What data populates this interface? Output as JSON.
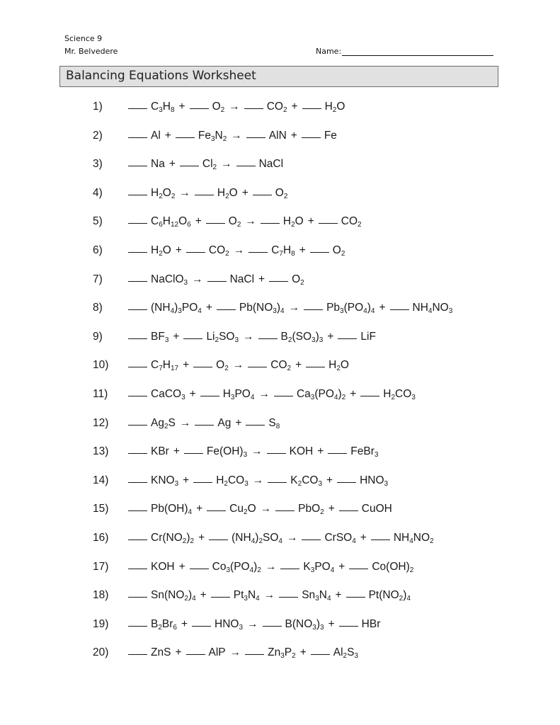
{
  "header": {
    "course": "Science 9",
    "teacher": "Mr. Belvedere",
    "name_label": "Name:"
  },
  "title": "Balancing Equations Worksheet",
  "symbols": {
    "plus": "+",
    "arrow": "→"
  },
  "equations": [
    {
      "number": "1)",
      "reactants": [
        [
          [
            "C"
          ],
          [
            "3",
            "s"
          ],
          [
            "H"
          ],
          [
            "8",
            "s"
          ]
        ],
        [
          [
            "O"
          ],
          [
            "2",
            "s"
          ]
        ]
      ],
      "products": [
        [
          [
            "CO"
          ],
          [
            "2",
            "s"
          ]
        ],
        [
          [
            "H"
          ],
          [
            "2",
            "s"
          ],
          [
            "O"
          ]
        ]
      ]
    },
    {
      "number": "2)",
      "reactants": [
        [
          [
            "Al"
          ]
        ],
        [
          [
            "Fe"
          ],
          [
            "3",
            "s"
          ],
          [
            "N"
          ],
          [
            "2",
            "s"
          ]
        ]
      ],
      "products": [
        [
          [
            "AlN"
          ]
        ],
        [
          [
            "Fe"
          ]
        ]
      ]
    },
    {
      "number": "3)",
      "reactants": [
        [
          [
            "Na"
          ]
        ],
        [
          [
            "Cl"
          ],
          [
            "2",
            "s"
          ]
        ]
      ],
      "products": [
        [
          [
            "NaCl"
          ]
        ]
      ]
    },
    {
      "number": "4)",
      "reactants": [
        [
          [
            "H"
          ],
          [
            "2",
            "s"
          ],
          [
            "O"
          ],
          [
            "2",
            "s"
          ]
        ]
      ],
      "products": [
        [
          [
            "H"
          ],
          [
            "2",
            "s"
          ],
          [
            "O"
          ]
        ],
        [
          [
            "O"
          ],
          [
            "2",
            "s"
          ]
        ]
      ]
    },
    {
      "number": "5)",
      "reactants": [
        [
          [
            "C"
          ],
          [
            "6",
            "s"
          ],
          [
            "H"
          ],
          [
            "12",
            "s"
          ],
          [
            "O"
          ],
          [
            "6",
            "s"
          ]
        ],
        [
          [
            "O"
          ],
          [
            "2",
            "s"
          ]
        ]
      ],
      "products": [
        [
          [
            "H"
          ],
          [
            "2",
            "s"
          ],
          [
            "O"
          ]
        ],
        [
          [
            "CO"
          ],
          [
            "2",
            "s"
          ]
        ]
      ]
    },
    {
      "number": "6)",
      "reactants": [
        [
          [
            "H"
          ],
          [
            "2",
            "s"
          ],
          [
            "O"
          ]
        ],
        [
          [
            "CO"
          ],
          [
            "2",
            "s"
          ]
        ]
      ],
      "products": [
        [
          [
            "C"
          ],
          [
            "7",
            "s"
          ],
          [
            "H"
          ],
          [
            "8",
            "s"
          ]
        ],
        [
          [
            "O"
          ],
          [
            "2",
            "s"
          ]
        ]
      ]
    },
    {
      "number": "7)",
      "reactants": [
        [
          [
            "NaClO"
          ],
          [
            "3",
            "s"
          ]
        ]
      ],
      "products": [
        [
          [
            "NaCl"
          ]
        ],
        [
          [
            "O"
          ],
          [
            "2",
            "s"
          ]
        ]
      ]
    },
    {
      "number": "8)",
      "reactants": [
        [
          [
            "(NH"
          ],
          [
            "4",
            "s"
          ],
          [
            ")"
          ],
          [
            "3",
            "s"
          ],
          [
            "PO"
          ],
          [
            "4",
            "s"
          ]
        ],
        [
          [
            "Pb(NO"
          ],
          [
            "3",
            "s"
          ],
          [
            ")"
          ],
          [
            "4",
            "s"
          ]
        ]
      ],
      "products": [
        [
          [
            "Pb"
          ],
          [
            "3",
            "s"
          ],
          [
            "(PO"
          ],
          [
            "4",
            "s"
          ],
          [
            ")"
          ],
          [
            "4",
            "s"
          ]
        ],
        [
          [
            "NH"
          ],
          [
            "4",
            "s"
          ],
          [
            "NO"
          ],
          [
            "3",
            "s"
          ]
        ]
      ]
    },
    {
      "number": "9)",
      "reactants": [
        [
          [
            "BF"
          ],
          [
            "3",
            "s"
          ]
        ],
        [
          [
            "Li"
          ],
          [
            "2",
            "s"
          ],
          [
            "SO"
          ],
          [
            "3",
            "s"
          ]
        ]
      ],
      "products": [
        [
          [
            "B"
          ],
          [
            "2",
            "s"
          ],
          [
            "(SO"
          ],
          [
            "3",
            "s"
          ],
          [
            ")"
          ],
          [
            "3",
            "s"
          ]
        ],
        [
          [
            "LiF"
          ]
        ]
      ]
    },
    {
      "number": "10)",
      "reactants": [
        [
          [
            "C"
          ],
          [
            "7",
            "s"
          ],
          [
            "H"
          ],
          [
            "17",
            "s"
          ]
        ],
        [
          [
            "O"
          ],
          [
            "2",
            "s"
          ]
        ]
      ],
      "products": [
        [
          [
            "CO"
          ],
          [
            "2",
            "s"
          ]
        ],
        [
          [
            "H"
          ],
          [
            "2",
            "s"
          ],
          [
            "O"
          ]
        ]
      ]
    },
    {
      "number": "11)",
      "reactants": [
        [
          [
            "CaCO"
          ],
          [
            "3",
            "s"
          ]
        ],
        [
          [
            "H"
          ],
          [
            "3",
            "s"
          ],
          [
            "PO"
          ],
          [
            "4",
            "s"
          ]
        ]
      ],
      "products": [
        [
          [
            "Ca"
          ],
          [
            "3",
            "s"
          ],
          [
            "(PO"
          ],
          [
            "4",
            "s"
          ],
          [
            ")"
          ],
          [
            "2",
            "s"
          ]
        ],
        [
          [
            "H"
          ],
          [
            "2",
            "s"
          ],
          [
            "CO"
          ],
          [
            "3",
            "s"
          ]
        ]
      ]
    },
    {
      "number": "12)",
      "reactants": [
        [
          [
            "Ag"
          ],
          [
            "2",
            "s"
          ],
          [
            "S"
          ]
        ]
      ],
      "products": [
        [
          [
            "Ag"
          ]
        ],
        [
          [
            "S"
          ],
          [
            "8",
            "s"
          ]
        ]
      ]
    },
    {
      "number": "13)",
      "reactants": [
        [
          [
            "KBr"
          ]
        ],
        [
          [
            "Fe(OH)"
          ],
          [
            "3",
            "s"
          ]
        ]
      ],
      "products": [
        [
          [
            "KOH"
          ]
        ],
        [
          [
            "FeBr"
          ],
          [
            "3",
            "s"
          ]
        ]
      ]
    },
    {
      "number": "14)",
      "reactants": [
        [
          [
            "KNO"
          ],
          [
            "3",
            "s"
          ]
        ],
        [
          [
            "H"
          ],
          [
            "2",
            "s"
          ],
          [
            "CO"
          ],
          [
            "3",
            "s"
          ]
        ]
      ],
      "products": [
        [
          [
            "K"
          ],
          [
            "2",
            "s"
          ],
          [
            "CO"
          ],
          [
            "3",
            "s"
          ]
        ],
        [
          [
            "HNO"
          ],
          [
            "3",
            "s"
          ]
        ]
      ]
    },
    {
      "number": "15)",
      "reactants": [
        [
          [
            "Pb(OH)"
          ],
          [
            "4",
            "s"
          ]
        ],
        [
          [
            "Cu"
          ],
          [
            "2",
            "s"
          ],
          [
            "O"
          ]
        ]
      ],
      "products": [
        [
          [
            "PbO"
          ],
          [
            "2",
            "s"
          ]
        ],
        [
          [
            "CuOH"
          ]
        ]
      ]
    },
    {
      "number": "16)",
      "reactants": [
        [
          [
            "Cr(NO"
          ],
          [
            "2",
            "s"
          ],
          [
            ")"
          ],
          [
            "2",
            "s"
          ]
        ],
        [
          [
            "(NH"
          ],
          [
            "4",
            "s"
          ],
          [
            ")"
          ],
          [
            "2",
            "s"
          ],
          [
            "SO"
          ],
          [
            "4",
            "s"
          ]
        ]
      ],
      "products": [
        [
          [
            "CrSO"
          ],
          [
            "4",
            "s"
          ]
        ],
        [
          [
            "NH"
          ],
          [
            "4",
            "s"
          ],
          [
            "NO"
          ],
          [
            "2",
            "s"
          ]
        ]
      ]
    },
    {
      "number": "17)",
      "reactants": [
        [
          [
            "KOH"
          ]
        ],
        [
          [
            "Co"
          ],
          [
            "3",
            "s"
          ],
          [
            "(PO"
          ],
          [
            "4",
            "s"
          ],
          [
            ")"
          ],
          [
            "2",
            "s"
          ]
        ]
      ],
      "products": [
        [
          [
            "K"
          ],
          [
            "3",
            "s"
          ],
          [
            "PO"
          ],
          [
            "4",
            "s"
          ]
        ],
        [
          [
            "Co(OH)"
          ],
          [
            "2",
            "s"
          ]
        ]
      ]
    },
    {
      "number": "18)",
      "reactants": [
        [
          [
            "Sn(NO"
          ],
          [
            "2",
            "s"
          ],
          [
            ")"
          ],
          [
            "4",
            "s"
          ]
        ],
        [
          [
            "Pt"
          ],
          [
            "3",
            "s"
          ],
          [
            "N"
          ],
          [
            "4",
            "s"
          ]
        ]
      ],
      "products": [
        [
          [
            "Sn"
          ],
          [
            "3",
            "s"
          ],
          [
            "N"
          ],
          [
            "4",
            "s"
          ]
        ],
        [
          [
            "Pt(NO"
          ],
          [
            "2",
            "s"
          ],
          [
            ")"
          ],
          [
            "4",
            "s"
          ]
        ]
      ]
    },
    {
      "number": "19)",
      "reactants": [
        [
          [
            "B"
          ],
          [
            "2",
            "s"
          ],
          [
            "Br"
          ],
          [
            "6",
            "s"
          ]
        ],
        [
          [
            "HNO"
          ],
          [
            "3",
            "s"
          ]
        ]
      ],
      "products": [
        [
          [
            "B(NO"
          ],
          [
            "3",
            "s"
          ],
          [
            ")"
          ],
          [
            "3",
            "s"
          ]
        ],
        [
          [
            "HBr"
          ]
        ]
      ]
    },
    {
      "number": "20)",
      "reactants": [
        [
          [
            "ZnS"
          ]
        ],
        [
          [
            "AlP"
          ]
        ]
      ],
      "products": [
        [
          [
            "Zn"
          ],
          [
            "3",
            "s"
          ],
          [
            "P"
          ],
          [
            "2",
            "s"
          ]
        ],
        [
          [
            "Al"
          ],
          [
            "2",
            "s"
          ],
          [
            "S"
          ],
          [
            "3",
            "s"
          ]
        ]
      ]
    }
  ]
}
